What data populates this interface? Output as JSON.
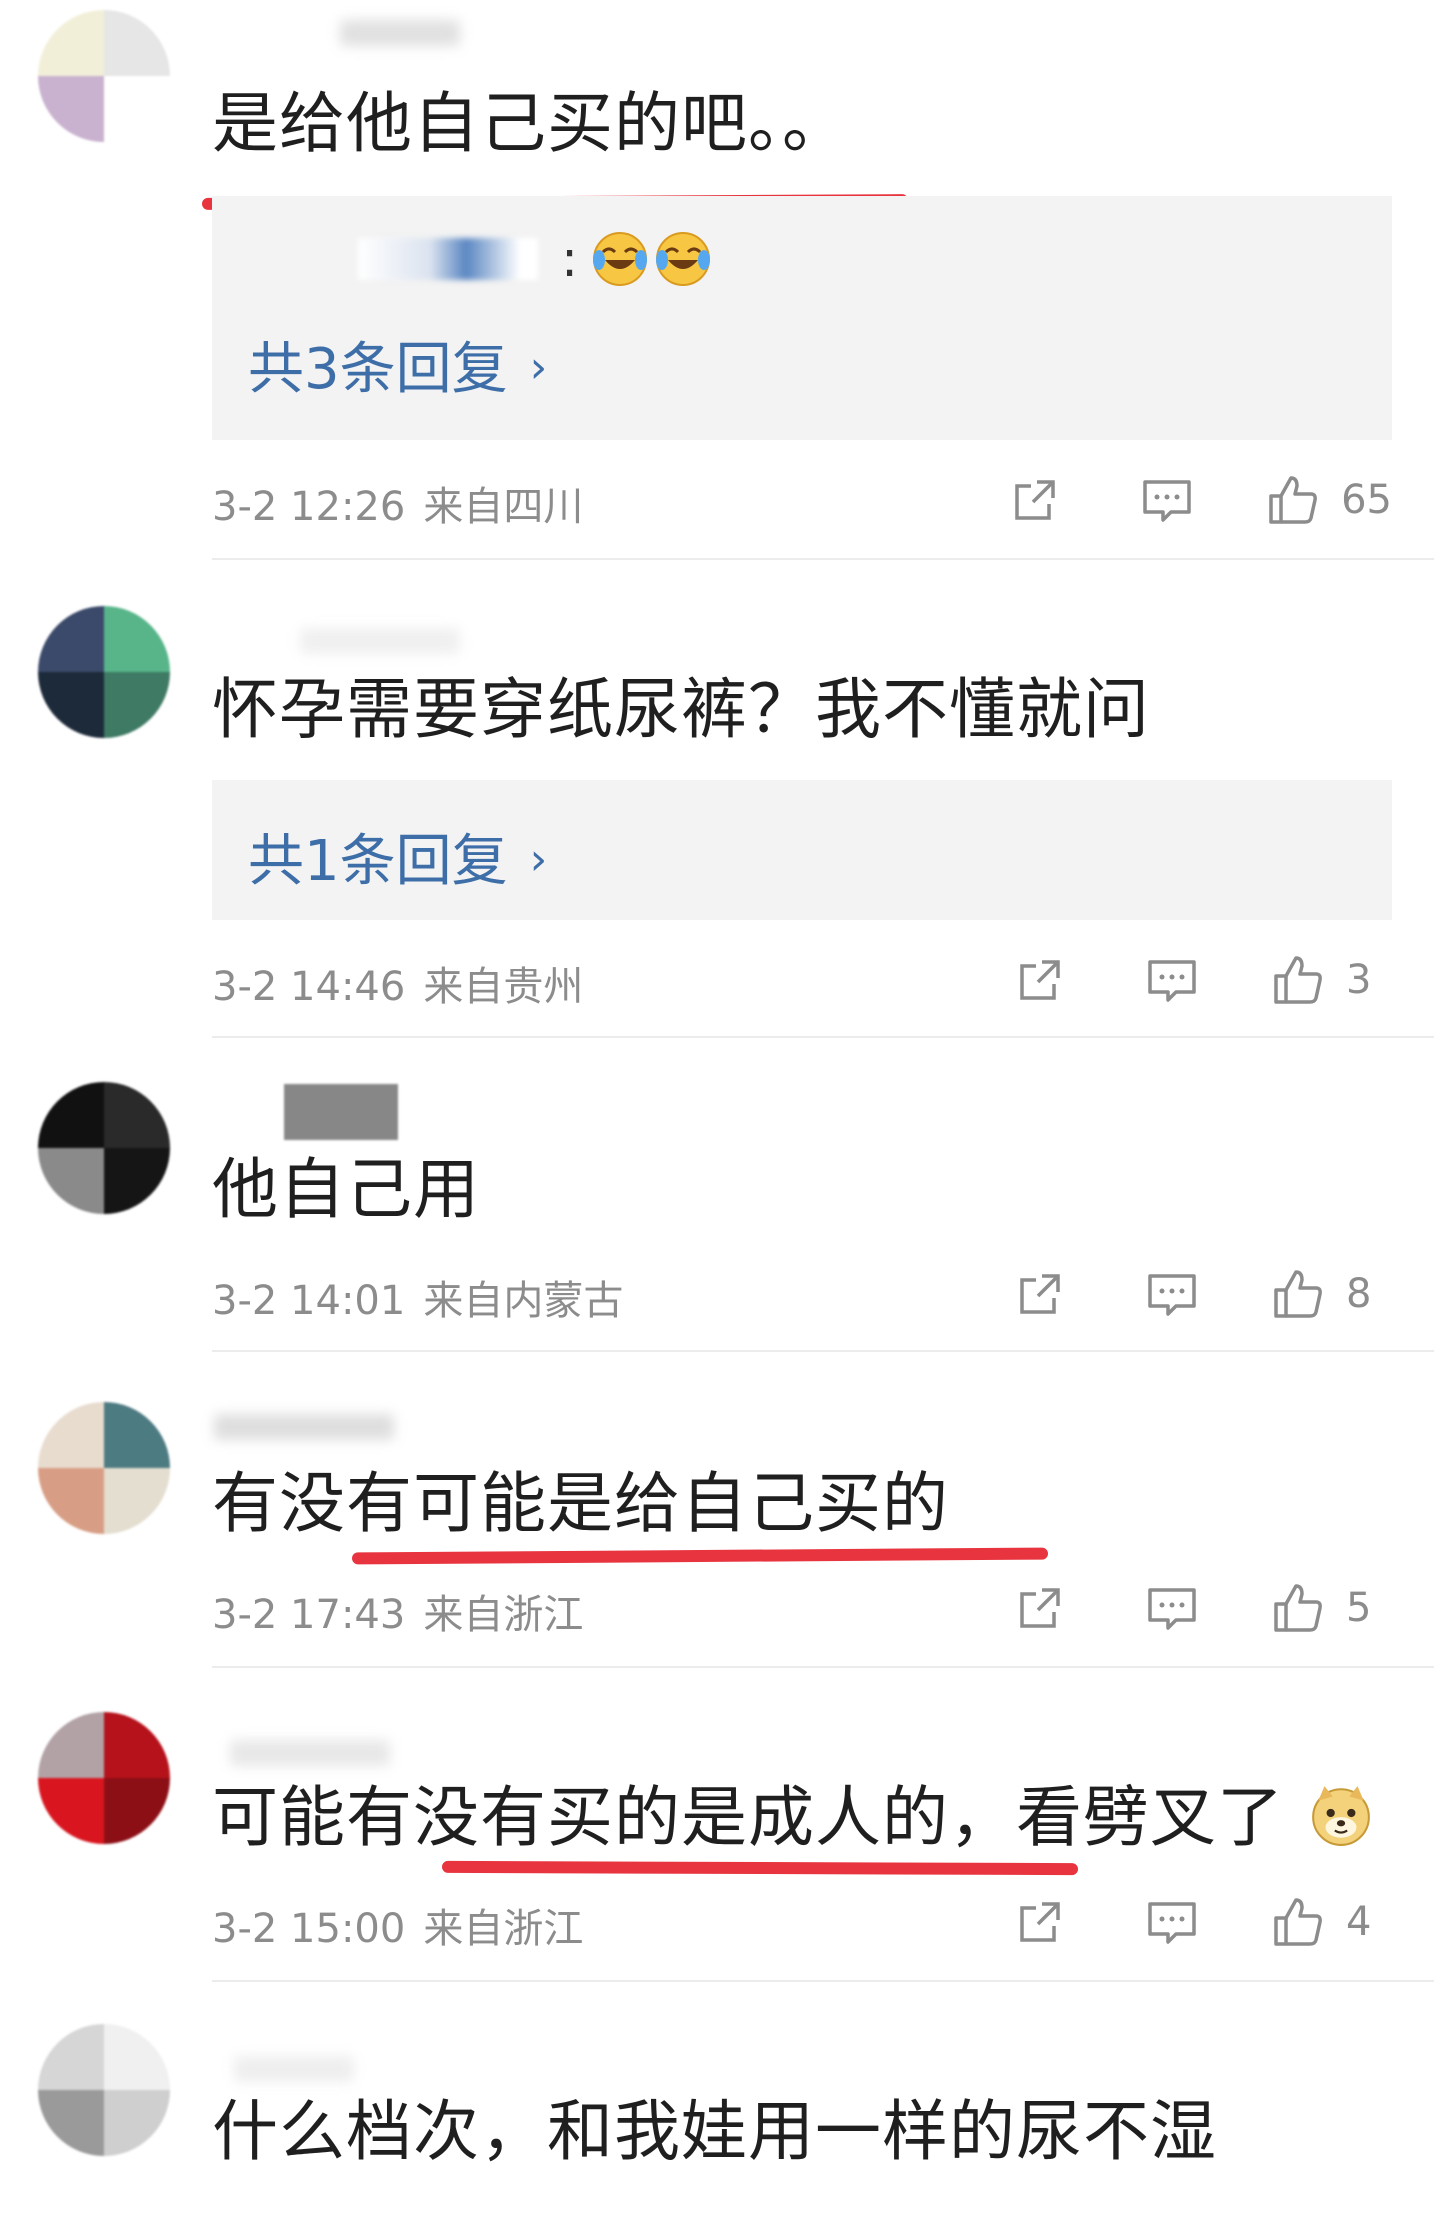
{
  "colors": {
    "accent_link": "#3d6ea8",
    "underline": "#e8343f",
    "meta": "#8c8c8c"
  },
  "comments": [
    {
      "text": "是给他自己买的吧。。",
      "reply_preview": ":",
      "reply_emojis": [
        "laugh-cry-emoji",
        "laugh-cry-emoji"
      ],
      "reply_link": "共3条回复",
      "date": "3-2 12:26",
      "region": "来自四川",
      "likes": "65"
    },
    {
      "text": "怀孕需要穿纸尿裤？我不懂就问",
      "reply_link": "共1条回复",
      "date": "3-2 14:46",
      "region": "来自贵州",
      "likes": "3"
    },
    {
      "text": "他自己用",
      "date": "3-2 14:01",
      "region": "来自内蒙古",
      "likes": "8"
    },
    {
      "text": "有没有可能是给自己买的",
      "date": "3-2 17:43",
      "region": "来自浙江",
      "likes": "5"
    },
    {
      "text": "可能有没有买的是成人的，看劈叉了",
      "trailing_emoji": "doge-emoji",
      "date": "3-2 15:00",
      "region": "来自浙江",
      "likes": "4"
    },
    {
      "text": "什么档次，和我娃用一样的尿不湿"
    }
  ],
  "icons": {
    "share": "share-icon",
    "comment": "comment-icon",
    "like": "thumbs-up-icon",
    "chevron": "chevron-right-icon"
  },
  "chevron_glyph": "›"
}
